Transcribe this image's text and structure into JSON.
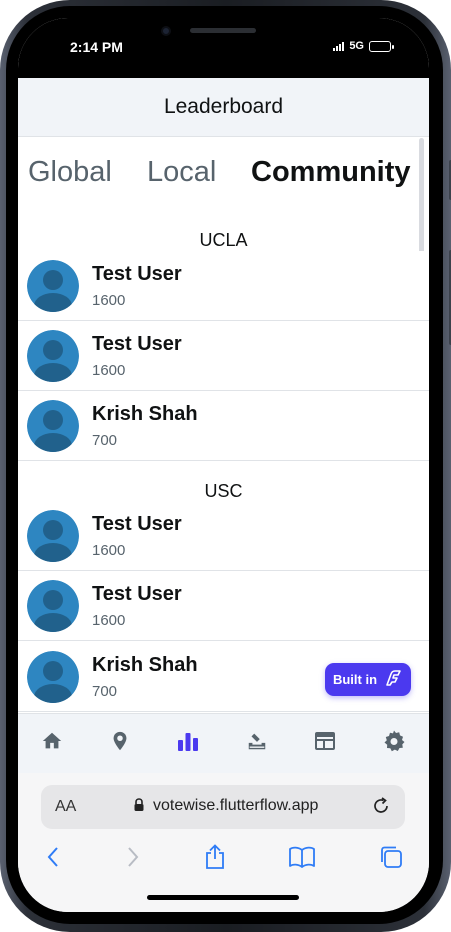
{
  "status_bar": {
    "time": "2:14 PM",
    "network": "5G"
  },
  "header": {
    "title": "Leaderboard"
  },
  "tabs": [
    {
      "label": "Global",
      "active": false
    },
    {
      "label": "Local",
      "active": false
    },
    {
      "label": "Community",
      "active": true
    }
  ],
  "groups": [
    {
      "name": "UCLA",
      "entries": [
        {
          "name": "Test User",
          "score": "1600"
        },
        {
          "name": "Test User",
          "score": "1600"
        },
        {
          "name": "Krish Shah",
          "score": "700"
        }
      ]
    },
    {
      "name": "USC",
      "entries": [
        {
          "name": "Test User",
          "score": "1600"
        },
        {
          "name": "Test User",
          "score": "1600"
        },
        {
          "name": "Krish Shah",
          "score": "700"
        }
      ]
    }
  ],
  "badge": {
    "label": "Built in"
  },
  "bottom_nav": {
    "items": [
      "home-icon",
      "location-pin-icon",
      "leaderboard-icon",
      "vote-box-icon",
      "ballot-table-icon",
      "settings-icon"
    ],
    "active": "leaderboard-icon"
  },
  "browser": {
    "text_size_label": "AA",
    "url": "votewise.flutterflow.app"
  },
  "colors": {
    "accent": "#4b39ef",
    "avatar": "#2e86c1",
    "avatar_figure": "#21618c",
    "header_bg": "#f1f4f8",
    "nav_icon": "#57636c",
    "safari_blue": "#2f7cf6"
  }
}
